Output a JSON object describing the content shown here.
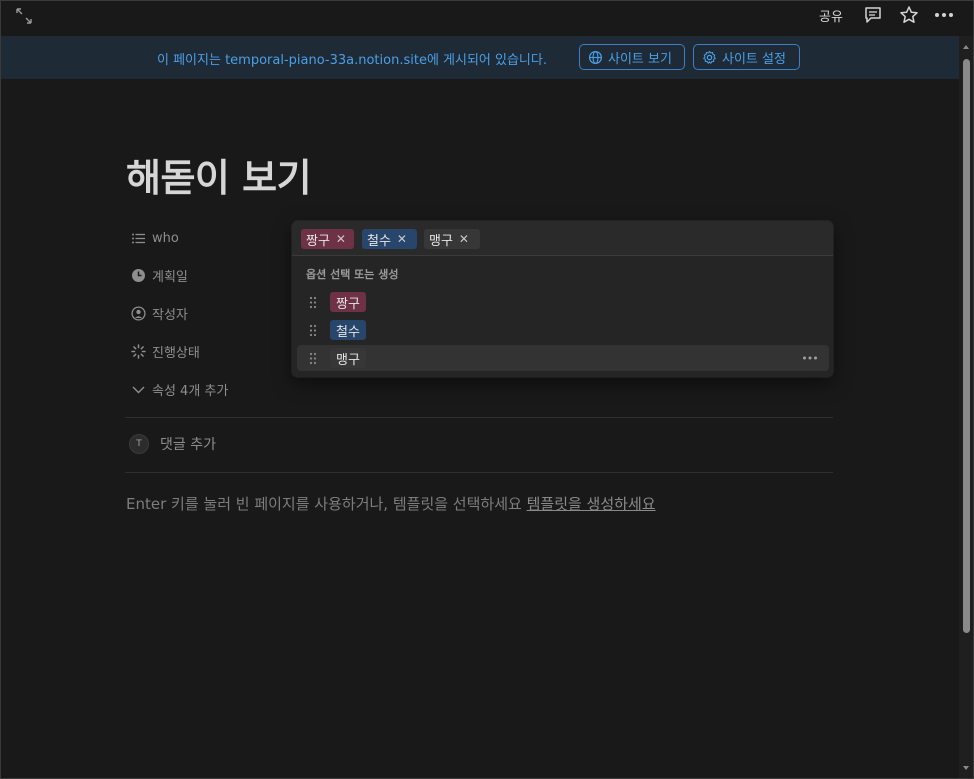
{
  "topbar": {
    "share_label": "공유"
  },
  "banner": {
    "message": "이 페이지는 temporal-piano-33a.notion.site에 게시되어 있습니다.",
    "view_site_label": "사이트 보기",
    "site_settings_label": "사이트 설정"
  },
  "page": {
    "title": "해돋이 보기",
    "properties": [
      {
        "label": "who",
        "icon": "list-icon"
      },
      {
        "label": "계획일",
        "icon": "clock-icon"
      },
      {
        "label": "작성자",
        "icon": "person-icon"
      },
      {
        "label": "진행상태",
        "icon": "loading-icon"
      }
    ],
    "more_properties_label": "속성 4개 추가",
    "comment_avatar_initial": "T",
    "comment_placeholder": "댓글 추가",
    "empty_hint": "Enter 키를 눌러 빈 페이지를 사용하거나, 템플릿을 선택하세요",
    "create_template_link": "템플릿을 생성하세요"
  },
  "popup": {
    "selected": [
      {
        "label": "짱구",
        "color": "#6e3146"
      },
      {
        "label": "철수",
        "color": "#28456c"
      },
      {
        "label": "맹구",
        "color": "#373737"
      }
    ],
    "section_label": "옵션 선택 또는 생성",
    "options": [
      {
        "label": "짱구",
        "color": "#6e3146"
      },
      {
        "label": "철수",
        "color": "#28456c"
      },
      {
        "label": "맹구",
        "color": "#373737"
      }
    ],
    "remove_glyph": "✕"
  },
  "colors": {
    "background": "#191919",
    "banner_bg": "#1e2a36",
    "accent_blue": "#4a9fe6"
  }
}
